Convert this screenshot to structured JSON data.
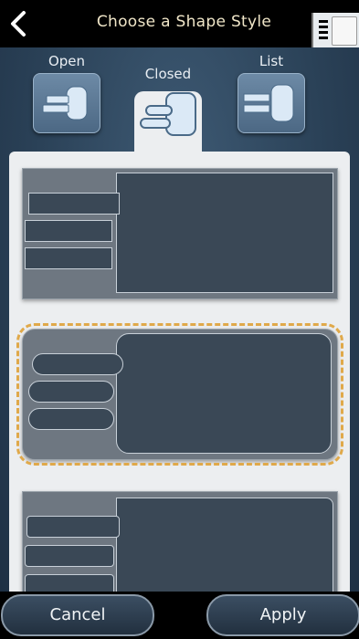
{
  "header": {
    "title": "Choose a Shape Style",
    "back_icon": "chevron-left-icon",
    "menu_icon": "panel-menu-icon"
  },
  "tabs": [
    {
      "label": "Open",
      "icon": "open-shape-icon"
    },
    {
      "label": "Closed",
      "icon": "closed-shape-icon",
      "selected": true
    },
    {
      "label": "List",
      "icon": "list-shape-icon"
    }
  ],
  "styles": [
    {
      "name": "square-style"
    },
    {
      "name": "rounded-style",
      "selected": true
    },
    {
      "name": "mixed-style"
    }
  ],
  "footer": {
    "cancel_label": "Cancel",
    "apply_label": "Apply"
  },
  "colors": {
    "accent_selection": "#e0a94a",
    "header_text": "#f0e6c8"
  }
}
